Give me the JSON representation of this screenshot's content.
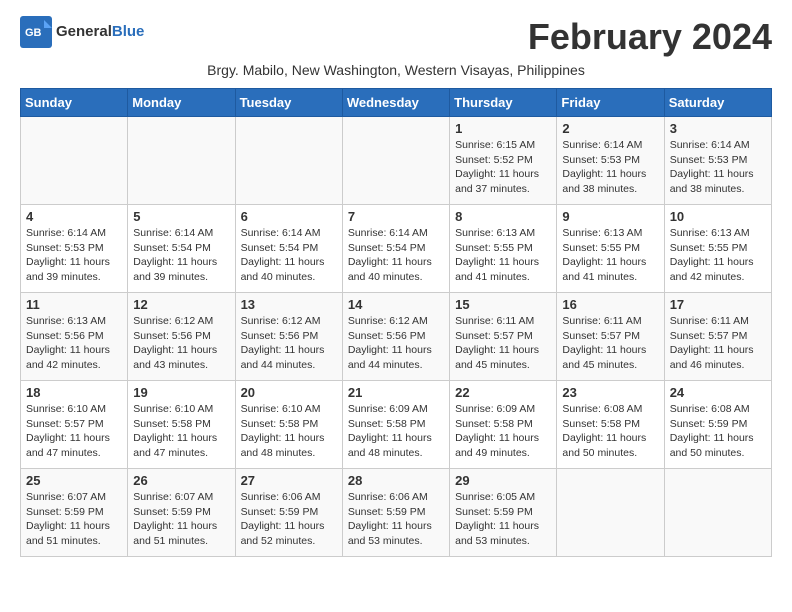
{
  "logo": {
    "text_general": "General",
    "text_blue": "Blue"
  },
  "title": "February 2024",
  "subtitle": "Brgy. Mabilo, New Washington, Western Visayas, Philippines",
  "headers": [
    "Sunday",
    "Monday",
    "Tuesday",
    "Wednesday",
    "Thursday",
    "Friday",
    "Saturday"
  ],
  "weeks": [
    [
      {
        "day": "",
        "info": ""
      },
      {
        "day": "",
        "info": ""
      },
      {
        "day": "",
        "info": ""
      },
      {
        "day": "",
        "info": ""
      },
      {
        "day": "1",
        "info": "Sunrise: 6:15 AM\nSunset: 5:52 PM\nDaylight: 11 hours\nand 37 minutes."
      },
      {
        "day": "2",
        "info": "Sunrise: 6:14 AM\nSunset: 5:53 PM\nDaylight: 11 hours\nand 38 minutes."
      },
      {
        "day": "3",
        "info": "Sunrise: 6:14 AM\nSunset: 5:53 PM\nDaylight: 11 hours\nand 38 minutes."
      }
    ],
    [
      {
        "day": "4",
        "info": "Sunrise: 6:14 AM\nSunset: 5:53 PM\nDaylight: 11 hours\nand 39 minutes."
      },
      {
        "day": "5",
        "info": "Sunrise: 6:14 AM\nSunset: 5:54 PM\nDaylight: 11 hours\nand 39 minutes."
      },
      {
        "day": "6",
        "info": "Sunrise: 6:14 AM\nSunset: 5:54 PM\nDaylight: 11 hours\nand 40 minutes."
      },
      {
        "day": "7",
        "info": "Sunrise: 6:14 AM\nSunset: 5:54 PM\nDaylight: 11 hours\nand 40 minutes."
      },
      {
        "day": "8",
        "info": "Sunrise: 6:13 AM\nSunset: 5:55 PM\nDaylight: 11 hours\nand 41 minutes."
      },
      {
        "day": "9",
        "info": "Sunrise: 6:13 AM\nSunset: 5:55 PM\nDaylight: 11 hours\nand 41 minutes."
      },
      {
        "day": "10",
        "info": "Sunrise: 6:13 AM\nSunset: 5:55 PM\nDaylight: 11 hours\nand 42 minutes."
      }
    ],
    [
      {
        "day": "11",
        "info": "Sunrise: 6:13 AM\nSunset: 5:56 PM\nDaylight: 11 hours\nand 42 minutes."
      },
      {
        "day": "12",
        "info": "Sunrise: 6:12 AM\nSunset: 5:56 PM\nDaylight: 11 hours\nand 43 minutes."
      },
      {
        "day": "13",
        "info": "Sunrise: 6:12 AM\nSunset: 5:56 PM\nDaylight: 11 hours\nand 44 minutes."
      },
      {
        "day": "14",
        "info": "Sunrise: 6:12 AM\nSunset: 5:56 PM\nDaylight: 11 hours\nand 44 minutes."
      },
      {
        "day": "15",
        "info": "Sunrise: 6:11 AM\nSunset: 5:57 PM\nDaylight: 11 hours\nand 45 minutes."
      },
      {
        "day": "16",
        "info": "Sunrise: 6:11 AM\nSunset: 5:57 PM\nDaylight: 11 hours\nand 45 minutes."
      },
      {
        "day": "17",
        "info": "Sunrise: 6:11 AM\nSunset: 5:57 PM\nDaylight: 11 hours\nand 46 minutes."
      }
    ],
    [
      {
        "day": "18",
        "info": "Sunrise: 6:10 AM\nSunset: 5:57 PM\nDaylight: 11 hours\nand 47 minutes."
      },
      {
        "day": "19",
        "info": "Sunrise: 6:10 AM\nSunset: 5:58 PM\nDaylight: 11 hours\nand 47 minutes."
      },
      {
        "day": "20",
        "info": "Sunrise: 6:10 AM\nSunset: 5:58 PM\nDaylight: 11 hours\nand 48 minutes."
      },
      {
        "day": "21",
        "info": "Sunrise: 6:09 AM\nSunset: 5:58 PM\nDaylight: 11 hours\nand 48 minutes."
      },
      {
        "day": "22",
        "info": "Sunrise: 6:09 AM\nSunset: 5:58 PM\nDaylight: 11 hours\nand 49 minutes."
      },
      {
        "day": "23",
        "info": "Sunrise: 6:08 AM\nSunset: 5:58 PM\nDaylight: 11 hours\nand 50 minutes."
      },
      {
        "day": "24",
        "info": "Sunrise: 6:08 AM\nSunset: 5:59 PM\nDaylight: 11 hours\nand 50 minutes."
      }
    ],
    [
      {
        "day": "25",
        "info": "Sunrise: 6:07 AM\nSunset: 5:59 PM\nDaylight: 11 hours\nand 51 minutes."
      },
      {
        "day": "26",
        "info": "Sunrise: 6:07 AM\nSunset: 5:59 PM\nDaylight: 11 hours\nand 51 minutes."
      },
      {
        "day": "27",
        "info": "Sunrise: 6:06 AM\nSunset: 5:59 PM\nDaylight: 11 hours\nand 52 minutes."
      },
      {
        "day": "28",
        "info": "Sunrise: 6:06 AM\nSunset: 5:59 PM\nDaylight: 11 hours\nand 53 minutes."
      },
      {
        "day": "29",
        "info": "Sunrise: 6:05 AM\nSunset: 5:59 PM\nDaylight: 11 hours\nand 53 minutes."
      },
      {
        "day": "",
        "info": ""
      },
      {
        "day": "",
        "info": ""
      }
    ]
  ]
}
